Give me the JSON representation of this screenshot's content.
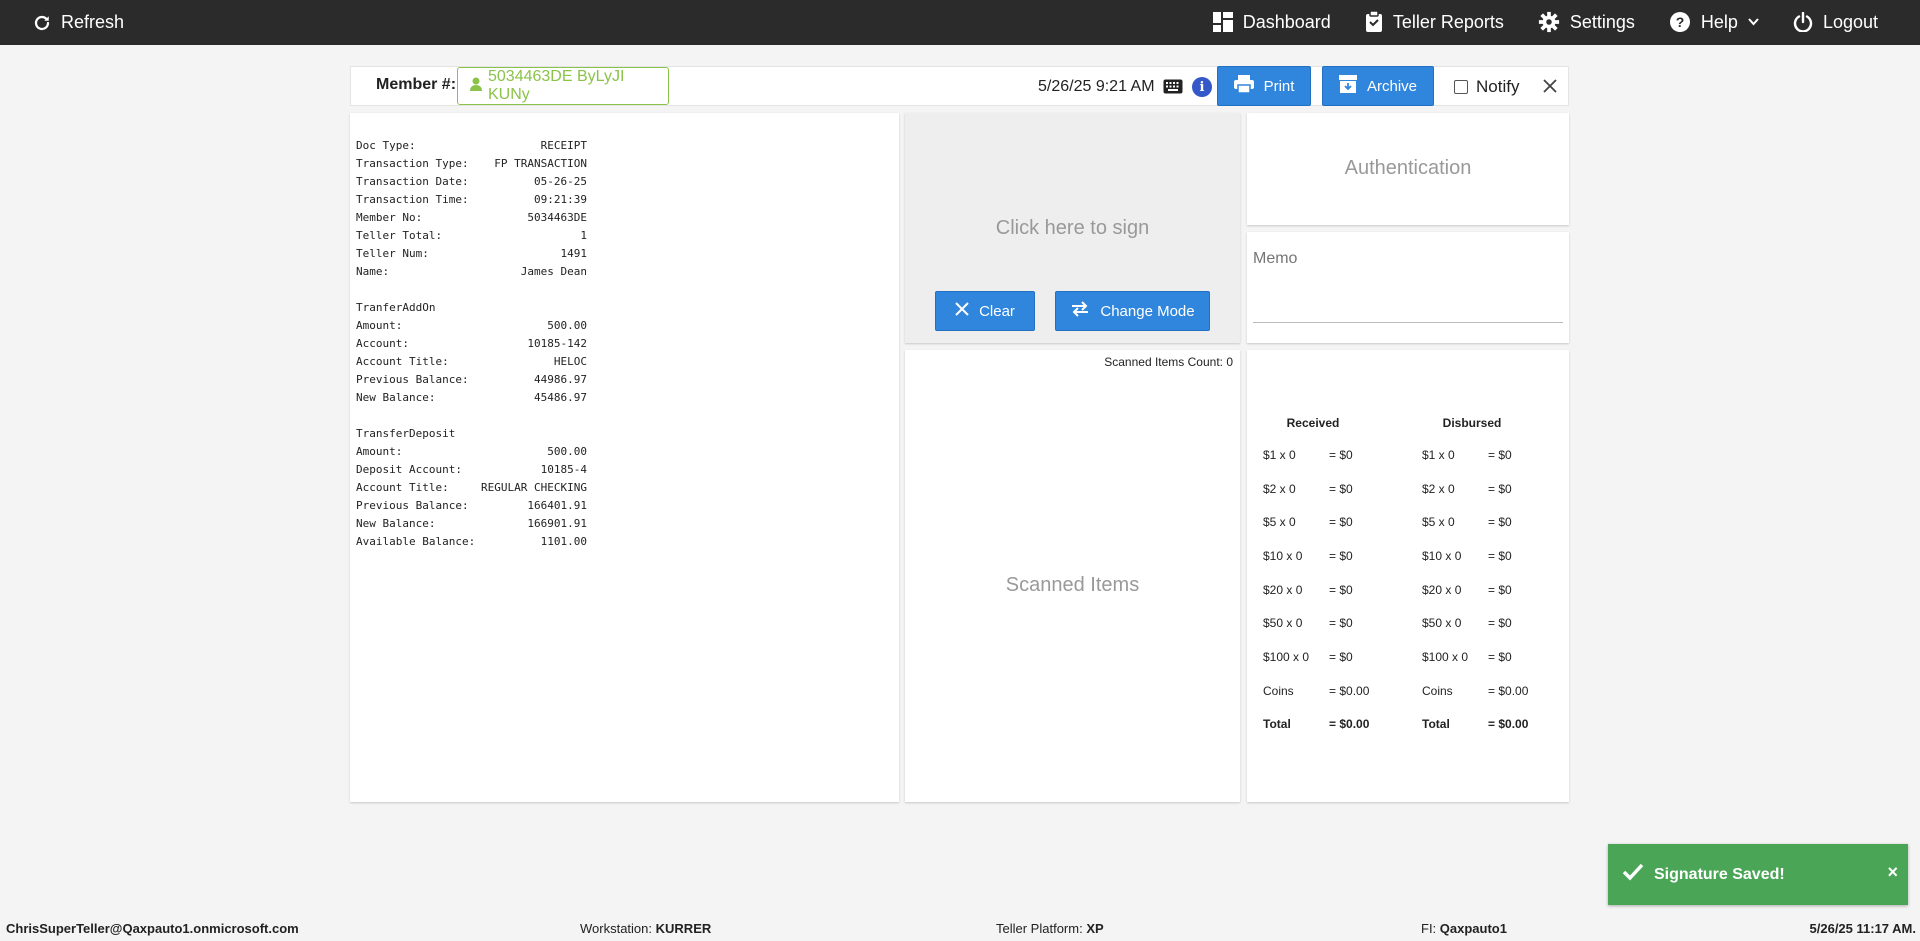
{
  "topbar": {
    "refresh_label": "Refresh",
    "dashboard_label": "Dashboard",
    "teller_reports_label": "Teller Reports",
    "settings_label": "Settings",
    "help_label": "Help",
    "logout_label": "Logout"
  },
  "memberbar": {
    "member_label": "Member #:",
    "member_value": "5034463DE ByLyJI KUNy",
    "datetime": "5/26/25 9:21 AM",
    "info_glyph": "i",
    "print_label": "Print",
    "archive_label": "Archive",
    "notify_label": "Notify",
    "notify_checked": false
  },
  "receipt": {
    "header": [
      {
        "k": "Doc Type:",
        "v": "RECEIPT"
      },
      {
        "k": "Transaction Type:",
        "v": "FP TRANSACTION"
      },
      {
        "k": "Transaction Date:",
        "v": "05-26-25"
      },
      {
        "k": "Transaction Time:",
        "v": "09:21:39"
      },
      {
        "k": "Member No:",
        "v": "5034463DE"
      },
      {
        "k": "Teller Total:",
        "v": "1"
      },
      {
        "k": "Teller Num:",
        "v": "1491"
      },
      {
        "k": "Name:",
        "v": "James Dean"
      }
    ],
    "section1_title": "TranferAddOn",
    "section1": [
      {
        "k": "Amount:",
        "v": "500.00"
      },
      {
        "k": "Account:",
        "v": "10185-142"
      },
      {
        "k": "Account Title:",
        "v": "HELOC"
      },
      {
        "k": "Previous Balance:",
        "v": "44986.97"
      },
      {
        "k": "New Balance:",
        "v": "45486.97"
      }
    ],
    "section2_title": "TransferDeposit",
    "section2": [
      {
        "k": "Amount:",
        "v": "500.00"
      },
      {
        "k": "Deposit Account:",
        "v": "10185-4"
      },
      {
        "k": "Account Title:",
        "v": "REGULAR CHECKING"
      },
      {
        "k": "Previous Balance:",
        "v": "166401.91"
      },
      {
        "k": "New Balance:",
        "v": "166901.91"
      },
      {
        "k": "Available Balance:",
        "v": "1101.00"
      }
    ]
  },
  "signature": {
    "prompt": "Click here to sign",
    "clear_label": "Clear",
    "change_mode_label": "Change Mode"
  },
  "scanned": {
    "count_label": "Scanned Items Count: 0",
    "placeholder": "Scanned Items"
  },
  "authentication": {
    "label": "Authentication"
  },
  "memo": {
    "placeholder": "Memo"
  },
  "cash": {
    "received_label": "Received",
    "disbursed_label": "Disbursed",
    "rows": [
      {
        "d": "$1 x 0",
        "v": "= $0"
      },
      {
        "d": "$2 x 0",
        "v": "= $0"
      },
      {
        "d": "$5 x 0",
        "v": "= $0"
      },
      {
        "d": "$10 x 0",
        "v": "= $0"
      },
      {
        "d": "$20 x 0",
        "v": "= $0"
      },
      {
        "d": "$50 x 0",
        "v": "= $0"
      },
      {
        "d": "$100 x 0",
        "v": "= $0"
      },
      {
        "d": "Coins",
        "v": "= $0.00"
      }
    ],
    "total_label": "Total",
    "total_value": "= $0.00"
  },
  "toast": {
    "message": "Signature Saved!",
    "close_glyph": "×",
    "color": "#4aa656"
  },
  "footer": {
    "user": "ChrisSuperTeller@Qaxpauto1.onmicrosoft.com",
    "workstation_label": "Workstation:",
    "workstation_value": "KURRER",
    "platform_label": "Teller Platform:",
    "platform_value": "XP",
    "fi_label": "FI:",
    "fi_value": "Qaxpauto1",
    "datetime": "5/26/25 11:17 AM."
  },
  "colors": {
    "navbar": "#2b2b2b",
    "button_blue": "#2f86dc",
    "member_green": "#8bc34a"
  }
}
